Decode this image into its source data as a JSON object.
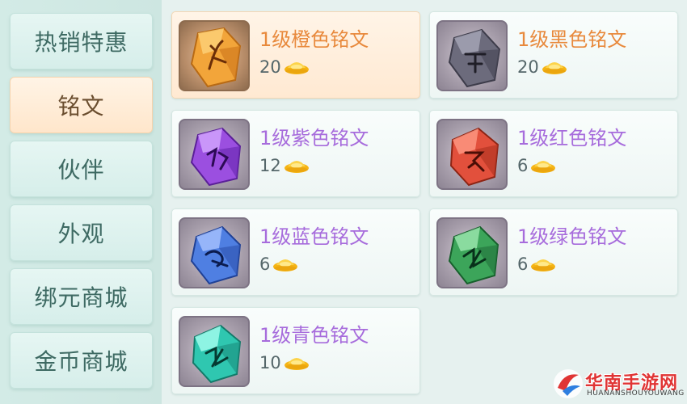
{
  "categories": [
    {
      "label": "热销特惠",
      "active": false
    },
    {
      "label": "铭文",
      "active": true
    },
    {
      "label": "伙伴",
      "active": false
    },
    {
      "label": "外观",
      "active": false
    },
    {
      "label": "绑元商城",
      "active": false
    },
    {
      "label": "金币商城",
      "active": false
    }
  ],
  "items": [
    {
      "name": "1级橙色铭文",
      "price": "20",
      "gem_color": "#f2a53a",
      "glyph": "orange-rune-gem-icon"
    },
    {
      "name": "1级黑色铭文",
      "price": "20",
      "gem_color": "#6c6b7c",
      "glyph": "black-rune-gem-icon"
    },
    {
      "name": "1级紫色铭文",
      "price": "12",
      "gem_color": "#9b4fe0",
      "glyph": "purple-rune-gem-icon"
    },
    {
      "name": "1级红色铭文",
      "price": "6",
      "gem_color": "#e2503c",
      "glyph": "red-rune-gem-icon"
    },
    {
      "name": "1级蓝色铭文",
      "price": "6",
      "gem_color": "#4f7fe2",
      "glyph": "blue-rune-gem-icon"
    },
    {
      "name": "1级绿色铭文",
      "price": "6",
      "gem_color": "#3ca55a",
      "glyph": "green-rune-gem-icon"
    },
    {
      "name": "1级青色铭文",
      "price": "10",
      "gem_color": "#2fc7b0",
      "glyph": "cyan-rune-gem-icon"
    }
  ],
  "currency_icon": "gold-ingot-icon",
  "watermark": {
    "title": "华南手游网",
    "subtitle": "HUANANSHOUYOUWANG"
  },
  "colors": {
    "name_purple": "#a76cdc",
    "name_orange": "#e8893c",
    "active_tab": "#ffe6cb",
    "tab": "#d6eeea"
  }
}
